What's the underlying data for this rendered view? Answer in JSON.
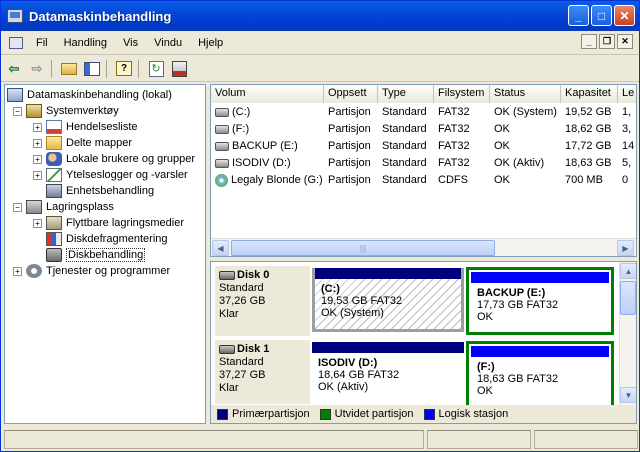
{
  "window": {
    "title": "Datamaskinbehandling"
  },
  "menu": [
    "Fil",
    "Handling",
    "Vis",
    "Vindu",
    "Hjelp"
  ],
  "window_buttons": {
    "minimize": "_",
    "maximize": "□",
    "close": "✕"
  },
  "mdi_buttons": {
    "minimize": "_",
    "restore": "❐",
    "close": "✕"
  },
  "toolbar": [
    "back-icon",
    "forward-icon",
    "up-folder-icon",
    "show-tree-icon",
    "help-icon",
    "refresh-icon",
    "properties-icon"
  ],
  "tree": [
    {
      "label": "Datamaskinbehandling (lokal)",
      "level": 0,
      "icon": "computer-icon",
      "expander": ""
    },
    {
      "label": "Systemverktøy",
      "level": 1,
      "icon": "tools-icon",
      "expander": "−"
    },
    {
      "label": "Hendelsesliste",
      "level": 2,
      "icon": "event-log-icon",
      "expander": "+"
    },
    {
      "label": "Delte mapper",
      "level": 2,
      "icon": "shared-folder-icon",
      "expander": "+"
    },
    {
      "label": "Lokale brukere og grupper",
      "level": 2,
      "icon": "users-icon",
      "expander": "+"
    },
    {
      "label": "Ytelseslogger og -varsler",
      "level": 2,
      "icon": "performance-icon",
      "expander": "+"
    },
    {
      "label": "Enhetsbehandling",
      "level": 2,
      "icon": "device-manager-icon",
      "expander": ""
    },
    {
      "label": "Lagringsplass",
      "level": 1,
      "icon": "storage-icon",
      "expander": "−"
    },
    {
      "label": "Flyttbare lagringsmedier",
      "level": 2,
      "icon": "removable-media-icon",
      "expander": "+"
    },
    {
      "label": "Diskdefragmentering",
      "level": 2,
      "icon": "defrag-icon",
      "expander": ""
    },
    {
      "label": "Diskbehandling",
      "level": 2,
      "icon": "disk-management-icon",
      "expander": "",
      "selected": true
    },
    {
      "label": "Tjenester og programmer",
      "level": 1,
      "icon": "services-icon",
      "expander": "+"
    }
  ],
  "volume_list": {
    "headers": [
      "Volum",
      "Oppsett",
      "Type",
      "Filsystem",
      "Status",
      "Kapasitet",
      "Le"
    ],
    "rows": [
      {
        "icon": "drive",
        "cells": [
          "(C:)",
          "Partisjon",
          "Standard",
          "FAT32",
          "OK (System)",
          "19,52 GB",
          "1,"
        ]
      },
      {
        "icon": "drive",
        "cells": [
          "(F:)",
          "Partisjon",
          "Standard",
          "FAT32",
          "OK",
          "18,62 GB",
          "3,"
        ]
      },
      {
        "icon": "drive",
        "cells": [
          "BACKUP (E:)",
          "Partisjon",
          "Standard",
          "FAT32",
          "OK",
          "17,72 GB",
          "14"
        ]
      },
      {
        "icon": "drive",
        "cells": [
          "ISODIV (D:)",
          "Partisjon",
          "Standard",
          "FAT32",
          "OK (Aktiv)",
          "18,63 GB",
          "5,"
        ]
      },
      {
        "icon": "cd",
        "cells": [
          "Legaly Blonde (G:)",
          "Partisjon",
          "Standard",
          "CDFS",
          "OK",
          "700 MB",
          "0"
        ]
      }
    ],
    "scroll_left": "◀",
    "scroll_right": "▶",
    "scroll_grip": "|||"
  },
  "disks": [
    {
      "name": "Disk 0",
      "type": "Standard",
      "size": "37,26 GB",
      "status": "Klar",
      "partitions": [
        {
          "name": "(C:)",
          "info": "19,53 GB FAT32",
          "status": "OK (System)",
          "kind": "primary"
        },
        {
          "name": "BACKUP  (E:)",
          "info": "17,73 GB FAT32",
          "status": "OK",
          "kind": "logical"
        }
      ]
    },
    {
      "name": "Disk 1",
      "type": "Standard",
      "size": "37,27 GB",
      "status": "Klar",
      "partitions": [
        {
          "name": "ISODIV  (D:)",
          "info": "18,64 GB FAT32",
          "status": "OK (Aktiv)",
          "kind": "primary"
        },
        {
          "name": "(F:)",
          "info": "18,63 GB FAT32",
          "status": "OK",
          "kind": "logical"
        }
      ]
    }
  ],
  "legend": [
    {
      "label": "Primærpartisjon",
      "color": "#00007f"
    },
    {
      "label": "Utvidet partisjon",
      "color": "#008000"
    },
    {
      "label": "Logisk stasjon",
      "color": "#0000ff"
    }
  ],
  "vscroll": {
    "up": "▲",
    "down": "▼"
  },
  "colors": {
    "titlebar": "#0348d8",
    "primary": "#00007f",
    "extended": "#008000",
    "logical": "#0000ff"
  }
}
